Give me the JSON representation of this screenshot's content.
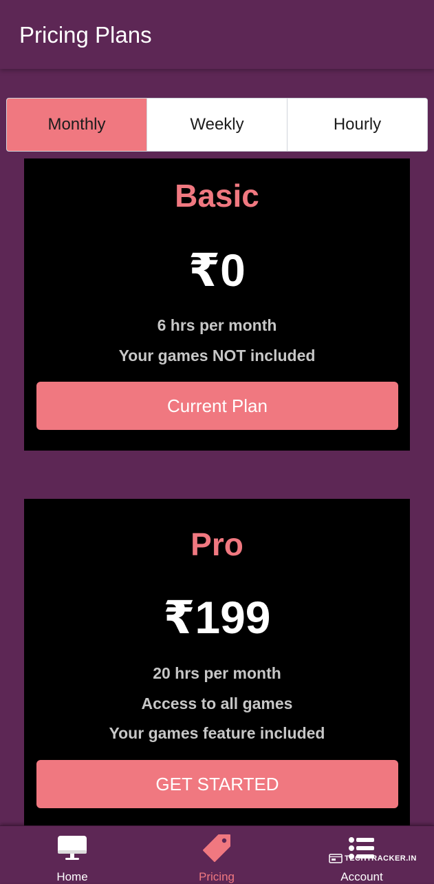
{
  "app_bar": {
    "title": "Pricing Plans"
  },
  "billing_tabs": [
    {
      "label": "Monthly",
      "active": true
    },
    {
      "label": "Weekly",
      "active": false
    },
    {
      "label": "Hourly",
      "active": false
    }
  ],
  "plans": [
    {
      "name": "Basic",
      "price": "₹0",
      "features": [
        "6 hrs per month",
        "Your games NOT included"
      ],
      "button_label": "Current Plan"
    },
    {
      "name": "Pro",
      "price": "₹199",
      "features": [
        "20 hrs per month",
        "Access to all games",
        "Your games feature included"
      ],
      "button_label": "GET STARTED"
    }
  ],
  "bottom_nav": {
    "items": [
      {
        "label": "Home",
        "icon": "monitor-icon",
        "active": false
      },
      {
        "label": "Pricing",
        "icon": "tag-icon",
        "active": true
      },
      {
        "label": "Account",
        "icon": "list-icon",
        "active": false
      }
    ]
  },
  "watermark": {
    "text": "TECHTRACKER.IN"
  },
  "colors": {
    "background": "#5d2755",
    "accent": "#f07880",
    "card": "#000000",
    "feature_text": "#c7c7c7"
  }
}
